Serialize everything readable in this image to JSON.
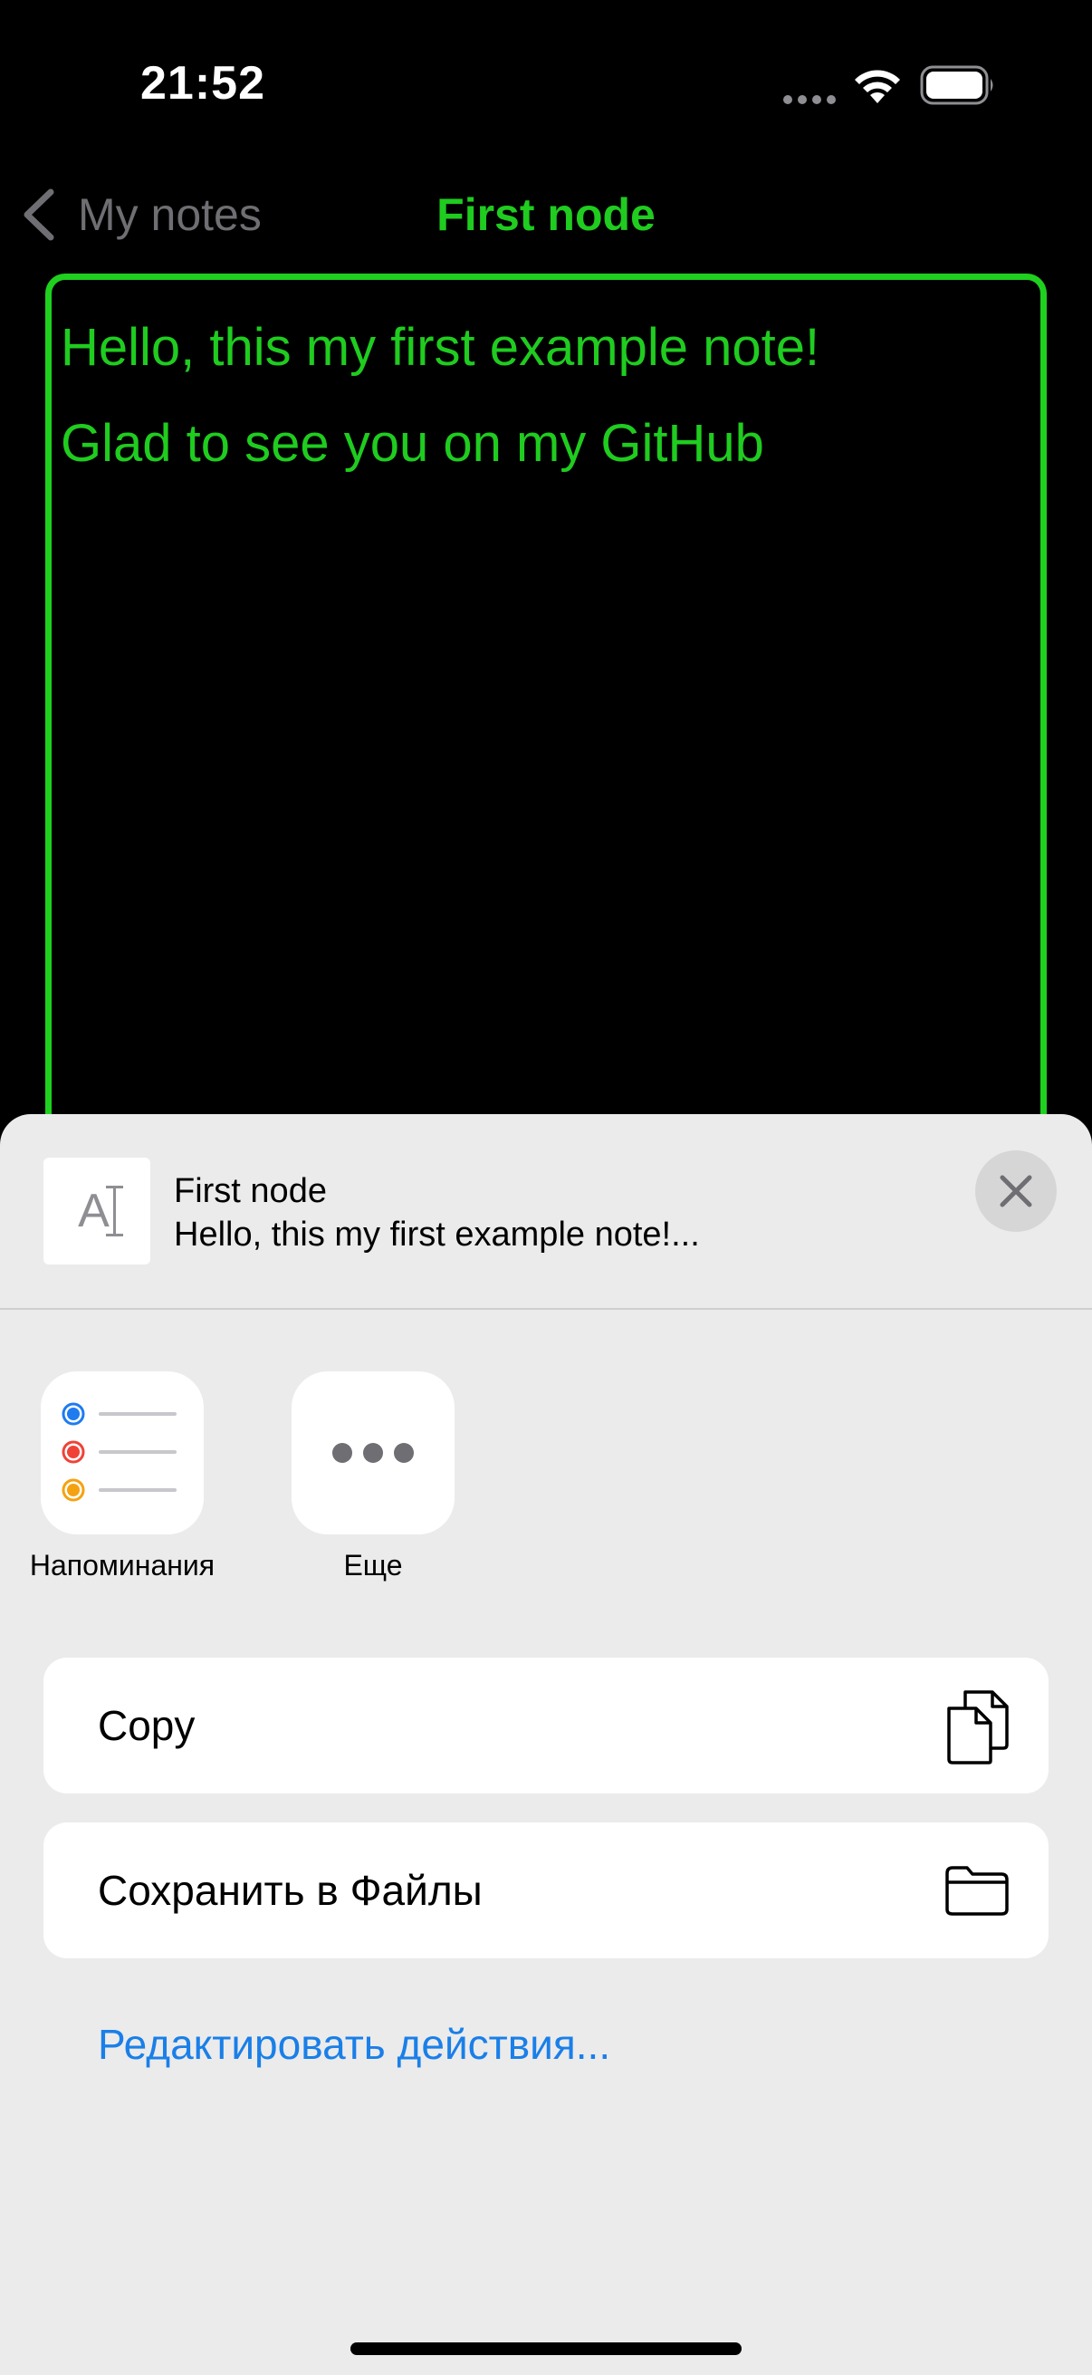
{
  "status_bar": {
    "time": "21:52"
  },
  "nav": {
    "back_label": "My notes",
    "title": "First node"
  },
  "note": {
    "lines": [
      "Hello, this my first example note!",
      "",
      "Glad to see you on my GitHub"
    ]
  },
  "share_sheet": {
    "doc_title": "First node",
    "doc_preview": "Hello, this my first example note!...",
    "doc_thumb_glyph": "A",
    "apps": [
      {
        "label": "Напоминания",
        "icon": "reminders-icon"
      },
      {
        "label": "Еще",
        "icon": "more-icon"
      }
    ],
    "actions": [
      {
        "label": "Copy",
        "icon": "copy-icon"
      },
      {
        "label": "Сохранить в Файлы",
        "icon": "folder-icon"
      }
    ],
    "edit_actions_label": "Редактировать действия..."
  },
  "colors": {
    "accent_green": "#1fcc1f",
    "link_blue": "#1a7fe8",
    "sheet_bg": "#ebebeb",
    "reminder_blue": "#1e7cf0",
    "reminder_red": "#ef4338",
    "reminder_orange": "#f5a211"
  }
}
